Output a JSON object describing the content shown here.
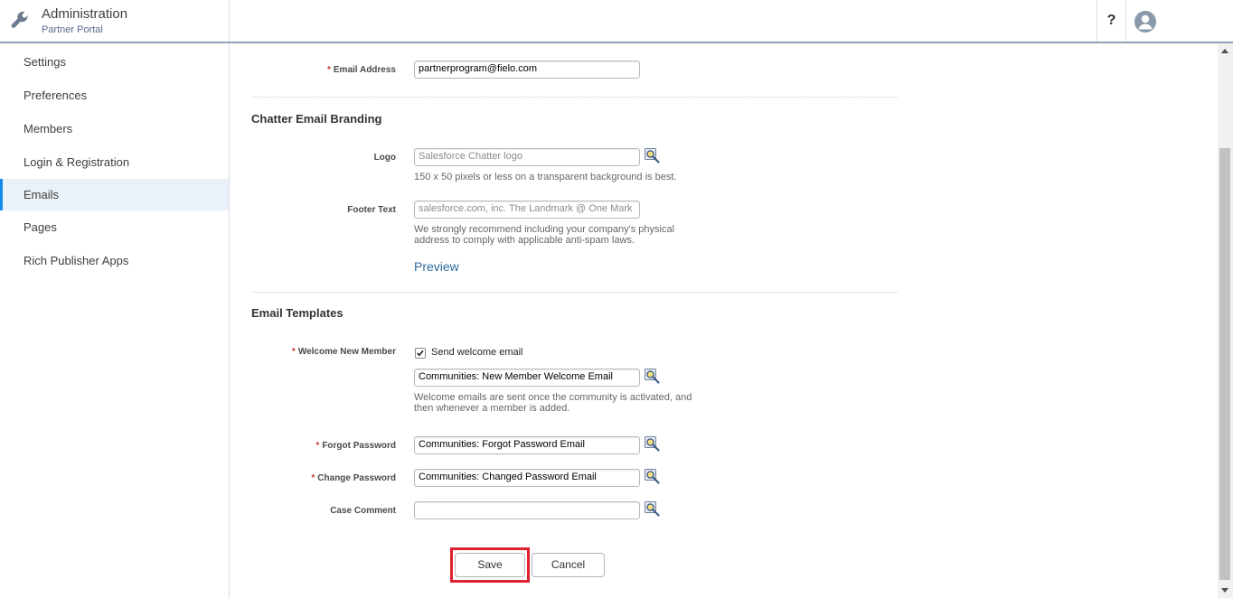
{
  "header": {
    "title": "Administration",
    "subtitle": "Partner Portal",
    "help_label": "?"
  },
  "sidebar": {
    "items": [
      {
        "label": "Settings"
      },
      {
        "label": "Preferences"
      },
      {
        "label": "Members"
      },
      {
        "label": "Login & Registration"
      },
      {
        "label": "Emails"
      },
      {
        "label": "Pages"
      },
      {
        "label": "Rich Publisher Apps"
      }
    ],
    "active": "Emails"
  },
  "form": {
    "email_address": {
      "label": "Email Address",
      "value": "partnerprogram@fielo.com"
    },
    "branding": {
      "title": "Chatter Email Branding",
      "logo": {
        "label": "Logo",
        "placeholder": "Salesforce Chatter logo",
        "help": "150 x 50 pixels or less on a transparent background is best."
      },
      "footer": {
        "label": "Footer Text",
        "placeholder": "salesforce.com, inc. The Landmark @ One Mark",
        "help": "We strongly recommend including your company's physical address to comply with applicable anti-spam laws."
      },
      "preview_label": "Preview"
    },
    "templates": {
      "title": "Email Templates",
      "welcome": {
        "label": "Welcome New Member",
        "checkbox_label": "Send welcome email",
        "checked": true,
        "value": "Communities: New Member Welcome Email",
        "help": "Welcome emails are sent once the community is activated, and then whenever a member is added."
      },
      "forgot": {
        "label": "Forgot Password",
        "value": "Communities: Forgot Password Email"
      },
      "change": {
        "label": "Change Password",
        "value": "Communities: Changed Password Email"
      },
      "case_comment": {
        "label": "Case Comment",
        "value": ""
      }
    },
    "required_mark": "*",
    "save_label": "Save",
    "cancel_label": "Cancel"
  },
  "colors": {
    "accent": "#1589ee",
    "highlight": "#e0202e",
    "link": "#2f6a9f",
    "required": "#c23934"
  }
}
